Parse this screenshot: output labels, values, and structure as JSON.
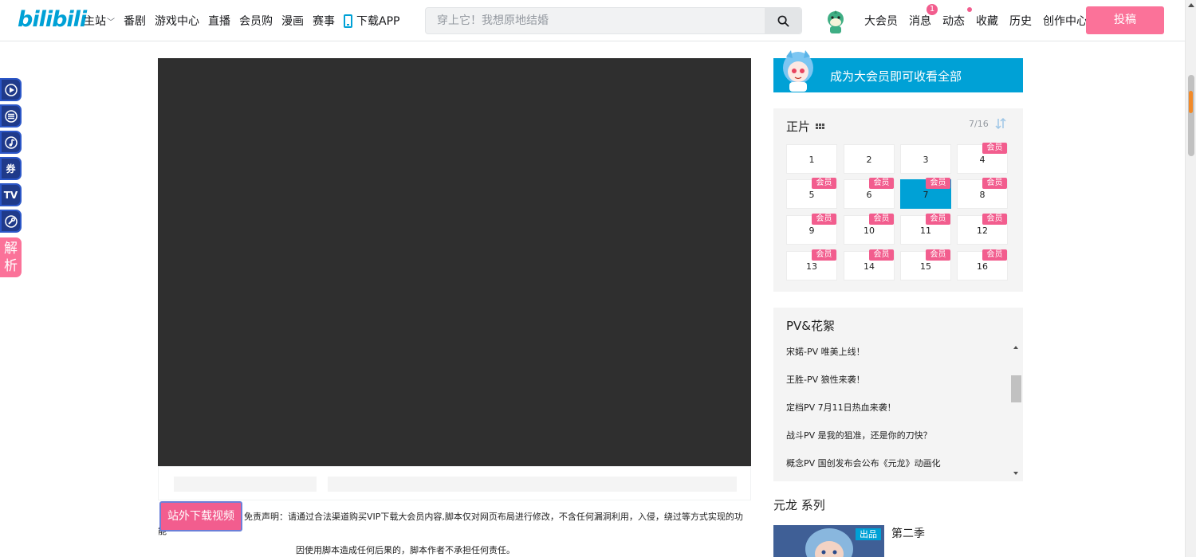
{
  "header": {
    "logo_text": "bilibili",
    "nav_left": [
      {
        "label": "主站",
        "has_chevron": true
      },
      {
        "label": "番剧"
      },
      {
        "label": "游戏中心"
      },
      {
        "label": "直播"
      },
      {
        "label": "会员购"
      },
      {
        "label": "漫画"
      },
      {
        "label": "赛事"
      }
    ],
    "download_app": "下载APP",
    "search": {
      "placeholder": "穿上它！我想原地结婚",
      "icon": "search-icon"
    },
    "nav_right": {
      "vip": "大会员",
      "messages": "消息",
      "messages_badge": "1",
      "dynamic": "动态",
      "favorites": "收藏",
      "history": "历史",
      "creator": "创作中心"
    },
    "upload_label": "投稿"
  },
  "side_tools": {
    "items": [
      "play-icon",
      "list-icon",
      "music-icon",
      "coupon-icon",
      "tv-icon",
      "wrench-icon"
    ],
    "coupon_glyph": "券",
    "tv_glyph": "TV",
    "parse_label_1": "解",
    "parse_label_2": "析"
  },
  "download_button": "站外下载视频",
  "disclaimer_line1": "免责声明：请通过合法渠道购买VIP下载大会员内容,脚本仅对网页布局进行修改，不含任何漏洞利用，入侵，绕过等方式实现的功能",
  "disclaimer_line2": "因使用脚本造成任何后果的，脚本作者不承担任何责任。",
  "vip_banner": "成为大会员即可收看全部",
  "episodes": {
    "title": "正片",
    "count": "7/16",
    "vip_tag": "会员",
    "active": 7,
    "list": [
      {
        "n": "1",
        "vip": false
      },
      {
        "n": "2",
        "vip": false
      },
      {
        "n": "3",
        "vip": false
      },
      {
        "n": "4",
        "vip": true
      },
      {
        "n": "5",
        "vip": true
      },
      {
        "n": "6",
        "vip": true
      },
      {
        "n": "7",
        "vip": true
      },
      {
        "n": "8",
        "vip": true
      },
      {
        "n": "9",
        "vip": true
      },
      {
        "n": "10",
        "vip": true
      },
      {
        "n": "11",
        "vip": true
      },
      {
        "n": "12",
        "vip": true
      },
      {
        "n": "13",
        "vip": true
      },
      {
        "n": "14",
        "vip": true
      },
      {
        "n": "15",
        "vip": true
      },
      {
        "n": "16",
        "vip": true
      }
    ]
  },
  "pv": {
    "title": "PV&花絮",
    "items": [
      "宋婼-PV 唯美上线！",
      "王胜-PV 狼性来袭！",
      "定档PV 7月11日热血来袭！",
      "战斗PV 是我的狙准，还是你的刀快？",
      "概念PV 国创发布会公布《元龙》动画化"
    ]
  },
  "series": {
    "title": "元龙 系列",
    "badge": "出品",
    "season": "第二季"
  },
  "colors": {
    "brand_blue": "#00a1d6",
    "brand_pink": "#fb7299",
    "vip_pink": "#f25d8e",
    "player_bg": "#2f2f2f"
  }
}
